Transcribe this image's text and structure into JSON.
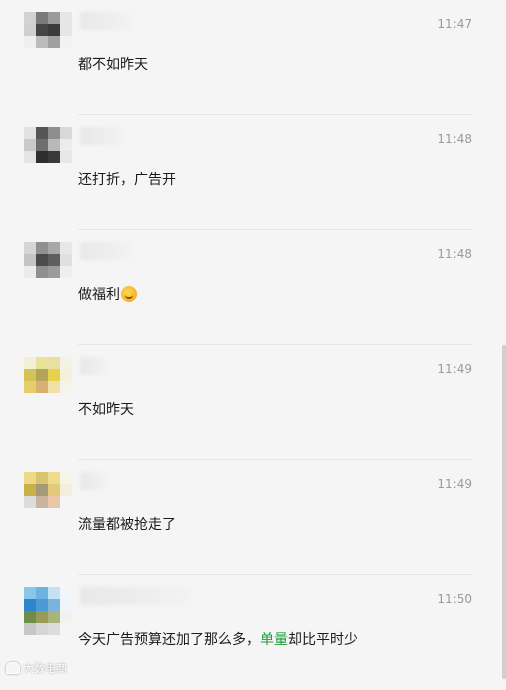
{
  "messages": [
    {
      "time": "11:47",
      "text": "都不如昨天",
      "avatar": [
        "#d2d2d2",
        "#7a7a7a",
        "#9a9a9a",
        "#e6e6e6",
        "#cfcfcf",
        "#454545",
        "#3b3b3b",
        "#e6e6e6",
        "#efefef",
        "#bcbcbc",
        "#a0a0a0",
        "#f2f2f2",
        "#f5f5f5",
        "#f5f5f5",
        "#f5f5f5",
        "#f5f5f5"
      ]
    },
    {
      "time": "11:48",
      "text": "还打折，广告开",
      "avatar": [
        "#e2e2e2",
        "#555555",
        "#8e8e8e",
        "#d8d8d8",
        "#c9c9c9",
        "#6e6e6e",
        "#b9b9b9",
        "#ececec",
        "#e4e4e4",
        "#2e2e2e",
        "#3a3a3a",
        "#e7e7e7",
        "#f5f5f5",
        "#f5f5f5",
        "#f5f5f5",
        "#f5f5f5"
      ]
    },
    {
      "time": "11:48",
      "text": "做福利",
      "has_emoji": true,
      "emoji_icon": "grin-emoji-icon",
      "avatar": [
        "#d6d6d6",
        "#909090",
        "#a8a8a8",
        "#e8e8e8",
        "#c4c4c4",
        "#4b4b4b",
        "#5e5e5e",
        "#e0e0e0",
        "#ececec",
        "#8f8f8f",
        "#9b9b9b",
        "#efefef",
        "#f5f5f5",
        "#f5f5f5",
        "#f5f5f5",
        "#f5f5f5"
      ]
    },
    {
      "time": "11:49",
      "text": "不如昨天",
      "avatar": [
        "#f1efd6",
        "#e9e39a",
        "#e8e0a0",
        "#f4f2e2",
        "#d7c25a",
        "#b4a35a",
        "#e8d24c",
        "#f4f0da",
        "#e6cf6a",
        "#d8b070",
        "#efe0a8",
        "#f6f4ea",
        "#f5f5f5",
        "#f5f5f5",
        "#f5f5f5",
        "#f5f5f5"
      ]
    },
    {
      "time": "11:49",
      "text": "流量都被抢走了",
      "avatar": [
        "#ecd98a",
        "#d8c46a",
        "#eedc8c",
        "#f6f4ea",
        "#c9b14a",
        "#a49a78",
        "#e2ca7a",
        "#f3eedb",
        "#dcdcdc",
        "#c8b4a0",
        "#e8c8a8",
        "#f5f5f5",
        "#f5f5f5",
        "#f5f5f5",
        "#f5f5f5",
        "#f5f5f5"
      ]
    },
    {
      "time": "11:50",
      "text_before": "今天广告预算还加了那么多，",
      "text_highlight": "单量",
      "text_after": "却比平时少",
      "highlight_color": "#1e9e3a",
      "avatar": [
        "#8ac6e8",
        "#6eb2e2",
        "#c5e2f2",
        "#f0f6fa",
        "#2e86c9",
        "#4a9ad6",
        "#7ab4de",
        "#eef4f8",
        "#6d8d4a",
        "#9a9a58",
        "#a8b47a",
        "#f2f2ec",
        "#c7c7c7",
        "#d6d6d6",
        "#dcdcdc",
        "#f5f5f5"
      ]
    }
  ],
  "watermark": {
    "text": "大数电商",
    "icon": "weibo-icon"
  }
}
